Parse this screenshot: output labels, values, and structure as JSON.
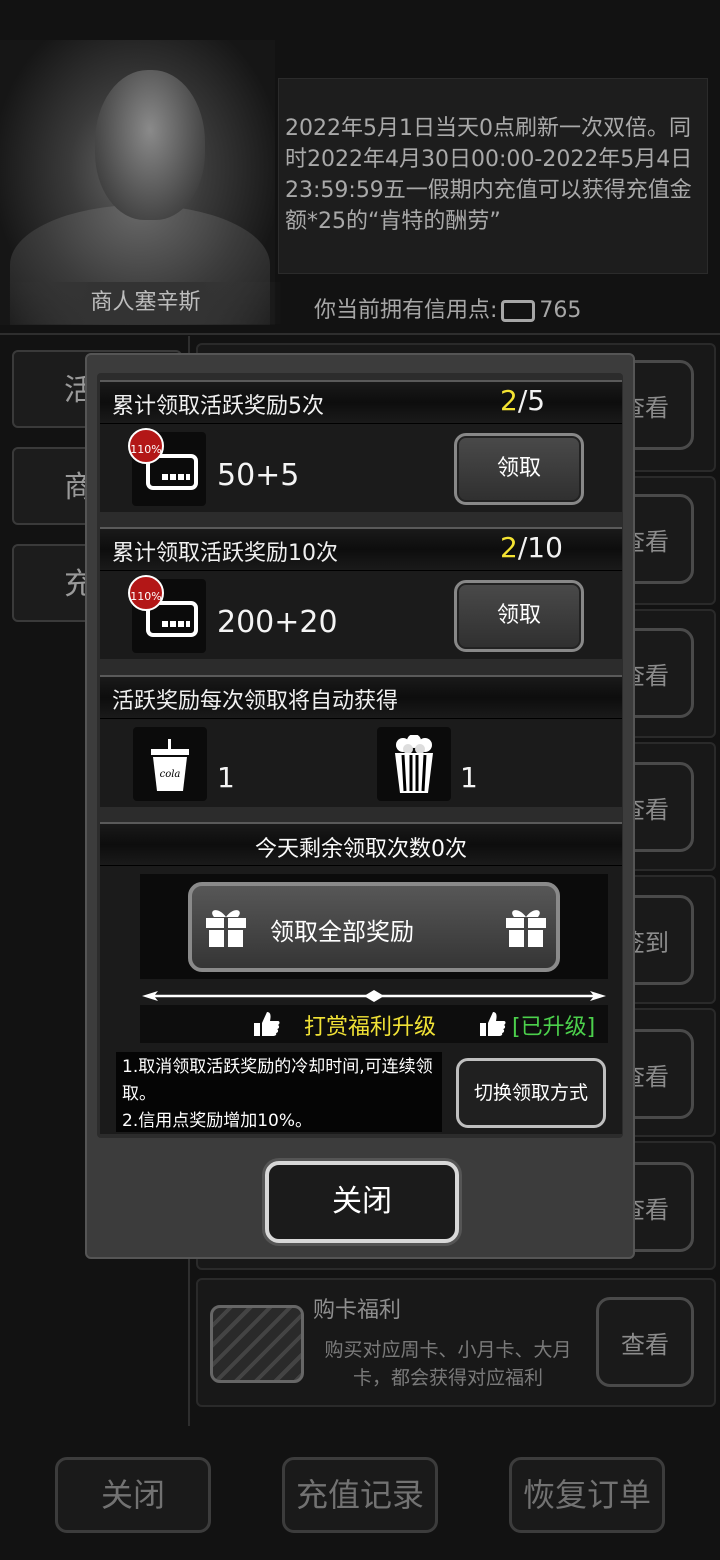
{
  "merchant": {
    "name": "商人塞辛斯"
  },
  "notice": {
    "text": "2022年5月1日当天0点刷新一次双倍。同时2022年4月30日00:00-2022年5月4日23:59:59五一假期内充值可以获得充值金额*25的“肯特的酬劳”"
  },
  "credit": {
    "label": "你当前拥有信用点:",
    "value": "765",
    "icon": "credit-card-icon"
  },
  "sidebar": {
    "items": [
      {
        "label": "活"
      },
      {
        "label": "商"
      },
      {
        "label": "充"
      }
    ]
  },
  "list": {
    "view_label": "查看",
    "checkin_label": "签到",
    "card_benefit": {
      "title": "购卡福利",
      "desc": "购买对应周卡、小月卡、大月卡，都会获得对应福利"
    }
  },
  "bottom_bar": {
    "close": "关闭",
    "history": "充值记录",
    "restore": "恢复订单"
  },
  "modal": {
    "rewards": [
      {
        "title": "累计领取活跃奖励5次",
        "current": "2",
        "total": "/5",
        "badge": "110%",
        "amount": "50+5",
        "button": "领取"
      },
      {
        "title": "累计领取活跃奖励10次",
        "current": "2",
        "total": "/10",
        "badge": "110%",
        "amount": "200+20",
        "button": "领取"
      }
    ],
    "auto": {
      "title": "活跃奖励每次领取将自动获得",
      "items": [
        {
          "icon": "cola-cup-icon",
          "cup_text": "cola",
          "count": "1"
        },
        {
          "icon": "popcorn-icon",
          "count": "1"
        }
      ]
    },
    "claim_all": {
      "remaining": "今天剩余领取次数0次",
      "button": "领取全部奖励",
      "upgrade_text": "打赏福利升级",
      "upgraded": "[已升级]",
      "desc_1": "1.取消领取活跃奖励的冷却时间,可连续领取。",
      "desc_2": "2.信用点奖励增加10%。",
      "switch_button": "切换领取方式"
    },
    "close_button": "关闭"
  }
}
